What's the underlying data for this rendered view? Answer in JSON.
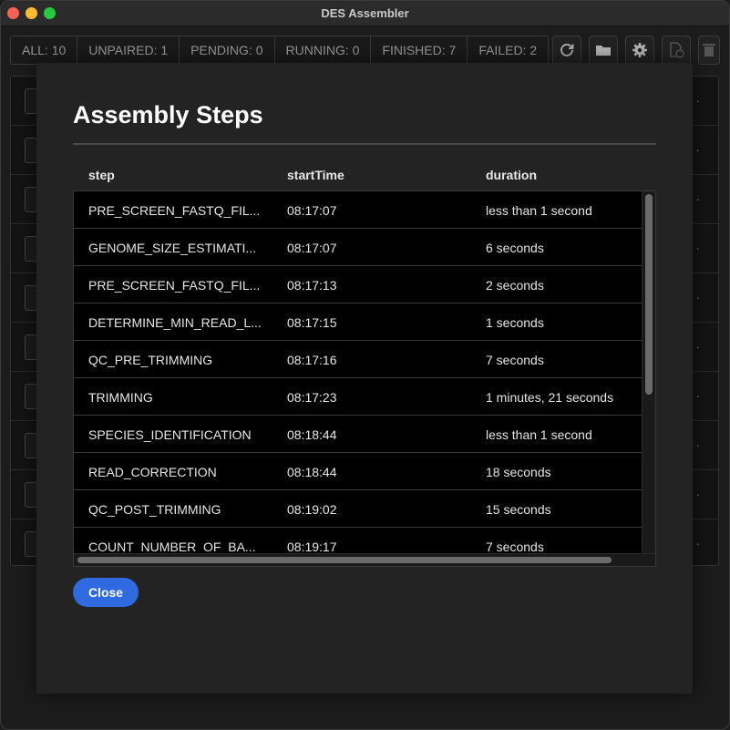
{
  "window": {
    "title": "DES Assembler"
  },
  "status": [
    {
      "label": "ALL: 10"
    },
    {
      "label": "UNPAIRED: 1"
    },
    {
      "label": "PENDING: 0"
    },
    {
      "label": "RUNNING: 0"
    },
    {
      "label": "FINISHED: 7"
    },
    {
      "label": "FAILED: 2"
    }
  ],
  "toolbar": {
    "icons": [
      "refresh-icon",
      "folder-icon",
      "gear-icon",
      "add-file-icon",
      "trash-icon"
    ]
  },
  "modal": {
    "title": "Assembly Steps",
    "columns": {
      "step": "step",
      "start": "startTime",
      "duration": "duration"
    },
    "rows": [
      {
        "step": "PRE_SCREEN_FASTQ_FIL...",
        "start": "08:17:07",
        "duration": "less than 1 second"
      },
      {
        "step": "GENOME_SIZE_ESTIMATI...",
        "start": "08:17:07",
        "duration": "6 seconds"
      },
      {
        "step": "PRE_SCREEN_FASTQ_FIL...",
        "start": "08:17:13",
        "duration": "2 seconds"
      },
      {
        "step": "DETERMINE_MIN_READ_L...",
        "start": "08:17:15",
        "duration": "1 seconds"
      },
      {
        "step": "QC_PRE_TRIMMING",
        "start": "08:17:16",
        "duration": "7 seconds"
      },
      {
        "step": "TRIMMING",
        "start": "08:17:23",
        "duration": "1 minutes, 21 seconds"
      },
      {
        "step": "SPECIES_IDENTIFICATION",
        "start": "08:18:44",
        "duration": "less than 1 second"
      },
      {
        "step": "READ_CORRECTION",
        "start": "08:18:44",
        "duration": "18 seconds"
      },
      {
        "step": "QC_POST_TRIMMING",
        "start": "08:19:02",
        "duration": "15 seconds"
      },
      {
        "step": "COUNT_NUMBER_OF_BA...",
        "start": "08:19:17",
        "duration": "7 seconds"
      }
    ],
    "close_label": "Close"
  },
  "colors": {
    "accent": "#2f6ae0"
  }
}
